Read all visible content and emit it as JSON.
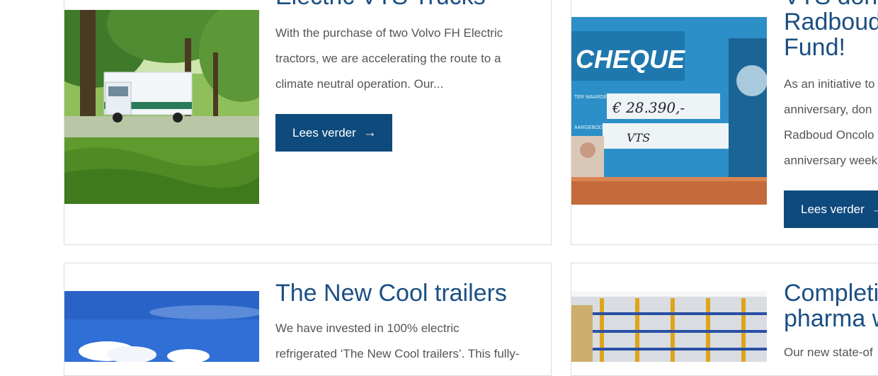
{
  "posts": [
    {
      "title": "Electric VTS Trucks",
      "excerpt": "With the purchase of two Volvo FH Electric tractors, we are accelerating the route to a climate neutral operation. Our...",
      "button": "Lees verder"
    },
    {
      "title_lines": [
        "VTS dona",
        "Radboud",
        "Fund!"
      ],
      "excerpt_lines": [
        "As an initiative to",
        "anniversary, don",
        "Radboud Oncolo",
        "anniversary week"
      ],
      "button": "Lees verder",
      "image_texts": {
        "cheque": "CHEQUE",
        "amount_label": "TER WAARDE VAN:",
        "amount": "€ 28.390,-",
        "offered_label": "AANGEBODEN DOOR:",
        "offered_by": "VTS"
      }
    },
    {
      "title": "The New Cool trailers",
      "excerpt_lines": [
        "We have invested in 100% electric",
        "refrigerated ‘The New Cool trailers’. This fully-"
      ]
    },
    {
      "title_lines": [
        "Completi",
        "pharma w"
      ],
      "excerpt_lines": [
        "Our new state-of"
      ]
    }
  ],
  "icons": {
    "arrow": "arrow-right-icon"
  }
}
